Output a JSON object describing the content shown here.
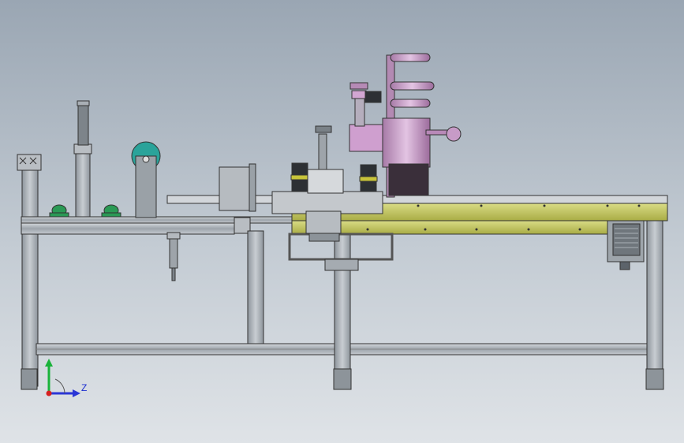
{
  "viewport": {
    "background_top": "#9aa6b3",
    "background_bottom": "#dfe3e7"
  },
  "model": {
    "frame_color": "#aeb4ba",
    "conveyor_plate_color": "#c9cc6a",
    "labeler_color": "#c8a2c8",
    "spool_color": "#2aa39a",
    "edge_color": "#333333"
  },
  "triad": {
    "z_label": "Z",
    "x_axis_color": "#2a36d6",
    "y_axis_color": "#19b33a",
    "origin_color": "#d62020"
  }
}
